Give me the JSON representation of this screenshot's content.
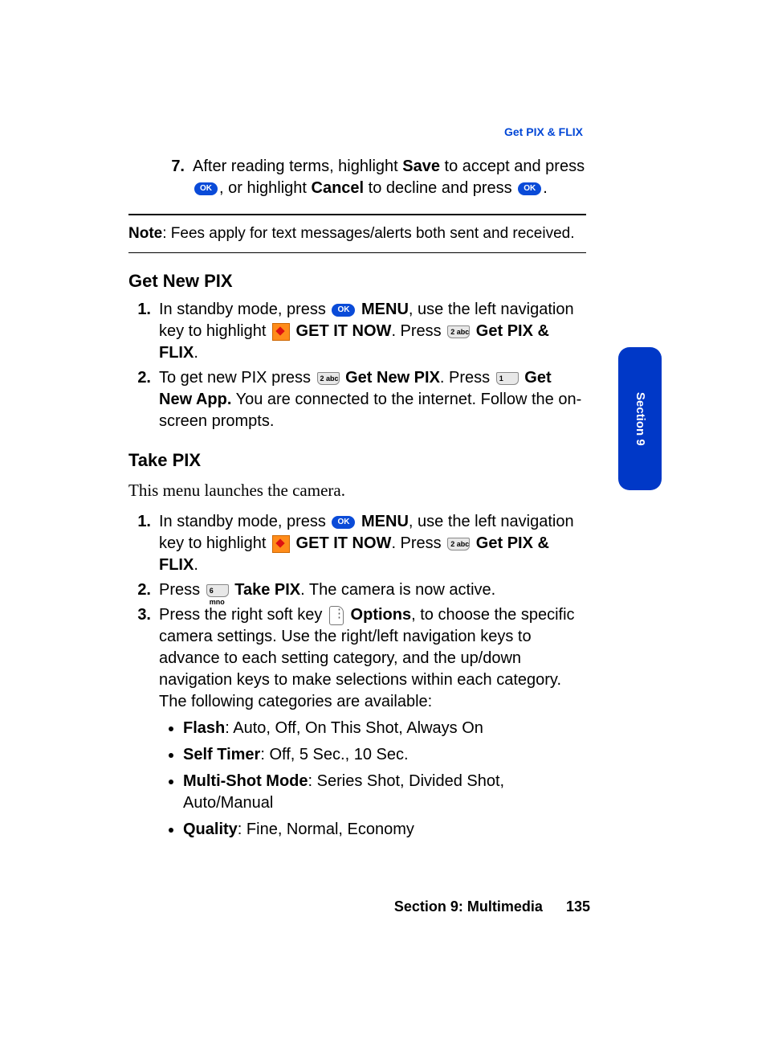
{
  "header_link": "Get PIX & FLIX",
  "side_tab": "Section 9",
  "top_step": {
    "num": "7.",
    "t1": "After reading terms, highlight ",
    "save": "Save",
    "t2": " to accept and press ",
    "ok1": "OK",
    "t3": ", or highlight ",
    "cancel": "Cancel",
    "t4": " to decline and press ",
    "ok2": "OK",
    "t5": "."
  },
  "note": {
    "label": "Note",
    "text": ": Fees apply for text messages/alerts both sent and received."
  },
  "h_getnew": "Get New PIX",
  "getnew": {
    "s1": {
      "num": "1.",
      "t1": "In standby mode, press ",
      "ok": "OK",
      "menu": "MENU",
      "t2": ", use the left navigation key to highlight ",
      "getit": "GET IT NOW",
      "t3": ". Press ",
      "key2": "2 abc",
      "getpix": "Get PIX & FLIX",
      "t4": "."
    },
    "s2": {
      "num": "2.",
      "t1": "To get new PIX press ",
      "key2": "2 abc",
      "getnewpix": "Get New PIX",
      "t2": ". Press ",
      "key1": "1",
      "getnewapp": "Get New App.",
      "t3": " You are connected to the internet. Follow the on-screen prompts."
    }
  },
  "h_takepix": "Take PIX",
  "serif": "This menu launches the camera.",
  "takepix": {
    "s1": {
      "num": "1.",
      "t1": "In standby mode, press ",
      "ok": "OK",
      "menu": "MENU",
      "t2": ", use the left navigation key to highlight ",
      "getit": "GET IT NOW",
      "t3": ". Press ",
      "key2": "2 abc",
      "getpix": "Get PIX & FLIX",
      "t4": "."
    },
    "s2": {
      "num": "2.",
      "t1": "Press ",
      "key6": "6 mno",
      "takepix": "Take PIX",
      "t2": ". The camera is now active."
    },
    "s3": {
      "num": "3.",
      "t1": "Press the right soft key ",
      "options": "Options",
      "t2": ", to choose the specific camera settings. Use the right/left navigation keys to advance to each setting category, and the up/down navigation keys to make selections within each category. The following categories are available:"
    }
  },
  "bullets": {
    "b1": {
      "label": "Flash",
      "vals": ": Auto, Off, On This Shot, Always On"
    },
    "b2": {
      "label": "Self Timer",
      "vals": ": Off, 5 Sec., 10 Sec."
    },
    "b3": {
      "label": "Multi-Shot Mode",
      "vals": ": Series Shot, Divided Shot, Auto/Manual"
    },
    "b4": {
      "label": "Quality",
      "vals": ": Fine, Normal, Economy"
    }
  },
  "footer": {
    "section": "Section 9: Multimedia",
    "page": "135"
  }
}
